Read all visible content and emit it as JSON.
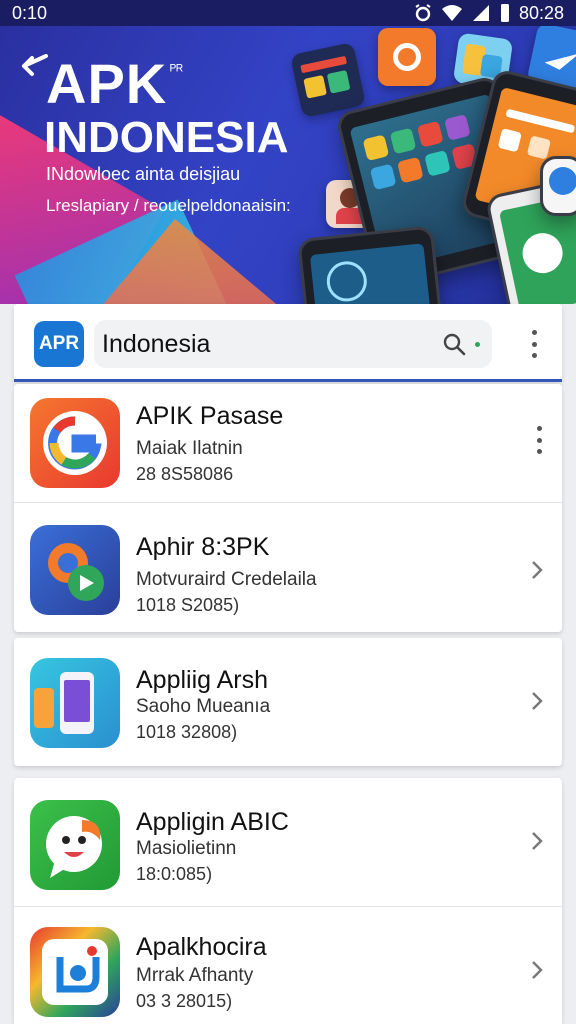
{
  "status_bar": {
    "time_left": "0:10",
    "time_right": "80:28"
  },
  "hero": {
    "title": "APK",
    "title_sup": "ᴾᴿ",
    "title2": "INDONESIA",
    "subtitle1": "INdowloec ainta deisjiau",
    "subtitle2": "Lreslapiary / reouelpeldonaaisin:"
  },
  "search": {
    "logo_text": "APR",
    "value": "Indonesia"
  },
  "apps": [
    {
      "name": "APIK Pasase",
      "developer": "Maiak Ilatnin",
      "meta": "28 8S58086",
      "action": "menu"
    },
    {
      "name": "Aphir 8:3PK",
      "developer": "Motvuraird Credelaila",
      "meta": "1018 S2085)",
      "action": "chevron"
    },
    {
      "name": "Appliig Arsh",
      "developer": "Saoho Mueanıa",
      "meta": "1018 32808)",
      "action": "chevron"
    },
    {
      "name": "Appligin ABIC",
      "developer": "Masiolietinn",
      "meta": "18:0:085)",
      "action": "chevron"
    },
    {
      "name": "Apalkhocira",
      "developer": "Mrrak Afhanty",
      "meta": "03 3 28015)",
      "action": "chevron"
    }
  ],
  "colors": {
    "accent": "#3457b8",
    "hero_bg": "#2f3fbf",
    "status_bar": "#1b1d63"
  }
}
